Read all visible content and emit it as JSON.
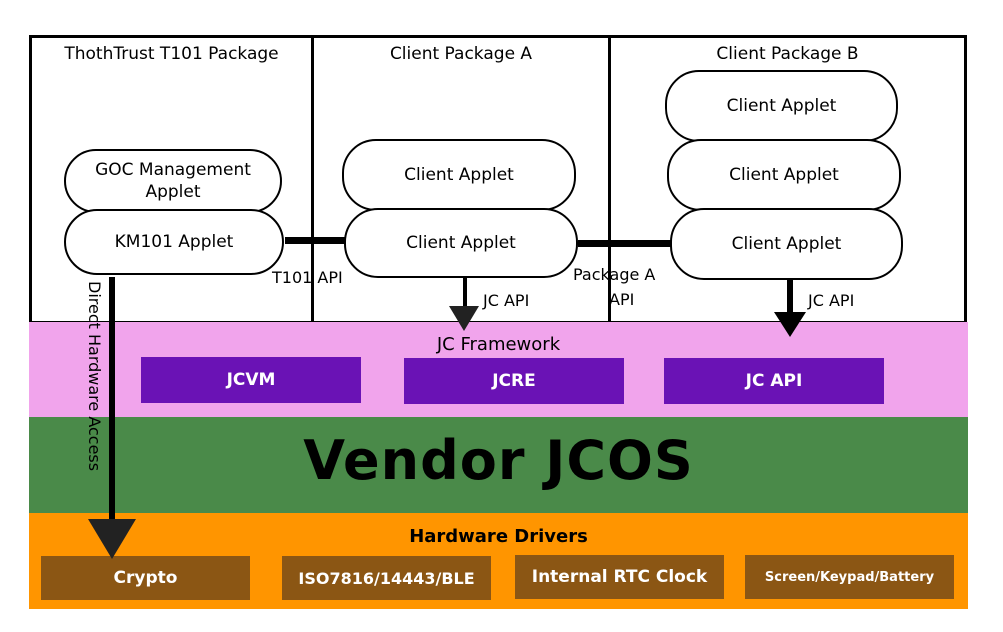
{
  "packages": [
    {
      "title": "ThothTrust T101 Package"
    },
    {
      "title": "Client Package A"
    },
    {
      "title": "Client Package B"
    }
  ],
  "applets": {
    "goc_management": "GOC Management Applet",
    "km101": "KM101 Applet",
    "client_a_top": "Client Applet",
    "client_a_bottom": "Client Applet",
    "client_b_top": "Client Applet",
    "client_b_middle": "Client Applet",
    "client_b_bottom": "Client Applet"
  },
  "connectors": {
    "t101_api": "T101 API",
    "package_a_api_line1": "Package A",
    "package_a_api_line2": "API",
    "jc_api_a": "JC API",
    "jc_api_b": "JC API",
    "direct_hardware_access": "Direct Hardware Access"
  },
  "layers": {
    "framework": {
      "title": "JC Framework",
      "color": "#f1a4ec",
      "components": [
        "JCVM",
        "JCRE",
        "JC API"
      ],
      "component_color": "#6a12b5"
    },
    "os": {
      "title": "Vendor JCOS",
      "color": "#4a8a49"
    },
    "hardware": {
      "title": "Hardware Drivers",
      "color": "#ff9500",
      "components": [
        "Crypto",
        "ISO7816/14443/BLE",
        "Internal RTC Clock",
        "Screen/Keypad/Battery"
      ],
      "component_color": "#8b5614"
    }
  }
}
